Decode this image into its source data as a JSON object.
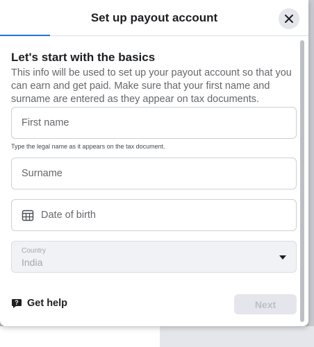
{
  "dialog": {
    "title": "Set up payout account",
    "close_icon": "close-icon"
  },
  "basics": {
    "heading": "Let's start with the basics",
    "description": "This info will be used to set up your payout account so that you can earn and get paid. Make sure that your first name and surname are entered as they appear on tax documents."
  },
  "form": {
    "first_name_placeholder": "First name",
    "first_name_hint": "Type the legal name as it appears on the tax document.",
    "surname_placeholder": "Surname",
    "dob_placeholder": "Date of birth",
    "dob_icon": "calendar-icon",
    "country_label": "Country",
    "country_value": "India",
    "country_icon": "dropdown-caret-icon"
  },
  "footer": {
    "help_label": "Get help",
    "help_icon": "help-icon",
    "next_label": "Next"
  },
  "colors": {
    "accent": "#1b74e4",
    "text_primary": "#1c1e21",
    "text_secondary": "#65676b",
    "disabled_bg": "#e4e6eb",
    "disabled_text": "#bcc0c4"
  }
}
